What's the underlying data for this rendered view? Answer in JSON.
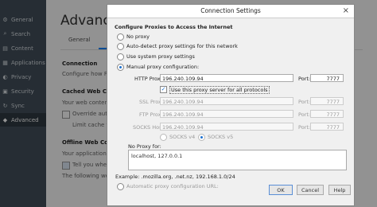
{
  "sidebar": {
    "items": [
      {
        "label": "General",
        "icon": "gear-icon"
      },
      {
        "label": "Search",
        "icon": "search-icon"
      },
      {
        "label": "Content",
        "icon": "content-icon"
      },
      {
        "label": "Applications",
        "icon": "applications-icon"
      },
      {
        "label": "Privacy",
        "icon": "privacy-icon"
      },
      {
        "label": "Security",
        "icon": "lock-icon"
      },
      {
        "label": "Sync",
        "icon": "sync-icon"
      },
      {
        "label": "Advanced",
        "icon": "advanced-icon"
      }
    ]
  },
  "main": {
    "title": "Advanced",
    "tabs": [
      "General",
      "N"
    ],
    "connection_heading": "Connection",
    "connection_text": "Configure how Fire",
    "cached_heading": "Cached Web Conte",
    "cached_text": "Your web content c",
    "override_label": "Override auto",
    "limit_label": "Limit cache to",
    "offline_heading": "Offline Web Conte",
    "offline_text": "Your application ca",
    "tell_label": "Tell you when",
    "following_text": "The following webs"
  },
  "dialog": {
    "title": "Connection Settings",
    "close_glyph": "×",
    "heading": "Configure Proxies to Access the Internet",
    "options": [
      {
        "label": "No proxy",
        "selected": false
      },
      {
        "label": "Auto-detect proxy settings for this network",
        "selected": false
      },
      {
        "label": "Use system proxy settings",
        "selected": false
      },
      {
        "label": "Manual proxy configuration:",
        "selected": true
      }
    ],
    "http_label": "HTTP Proxy:",
    "http_value": "196.240.109.94",
    "port_label": "Port:",
    "http_port": "7777",
    "use_all_label": "Use this proxy server for all protocols",
    "ssl_label": "SSL Proxy:",
    "ssl_value": "196.240.109.94",
    "ssl_port": "7777",
    "ftp_label": "FTP Proxy:",
    "ftp_value": "196.240.109.94",
    "ftp_port": "7777",
    "socks_label": "SOCKS Host:",
    "socks_value": "196.240.109.94",
    "socks_port": "7777",
    "socks_v4": "SOCKS v4",
    "socks_v5": "SOCKS v5",
    "no_proxy_label": "No Proxy for:",
    "no_proxy_value": "localhost, 127.0.0.1",
    "example": "Example: .mozilla.org, .net.nz, 192.168.1.0/24",
    "auto_config_partial": "Automatic proxy configuration URL:",
    "ok": "OK",
    "cancel": "Cancel",
    "help": "Help"
  }
}
